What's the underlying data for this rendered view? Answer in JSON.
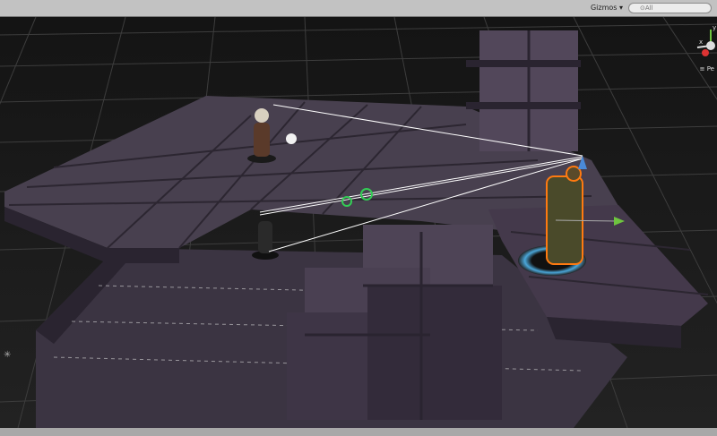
{
  "toolbar": {
    "gizmos_label": "Gizmos ▾",
    "search_placeholder": "⊙All"
  },
  "scene_gizmo": {
    "y_label": "y",
    "x_label": "x",
    "projection_label": "≡ Pe"
  },
  "colors": {
    "toolbar": "#c2c2c2",
    "floor_top": "#48404f",
    "floor_side": "#2a2430",
    "selection_outline": "#ff7a10",
    "sight_line": "#ffffff",
    "waypoint": "#33cc55"
  }
}
